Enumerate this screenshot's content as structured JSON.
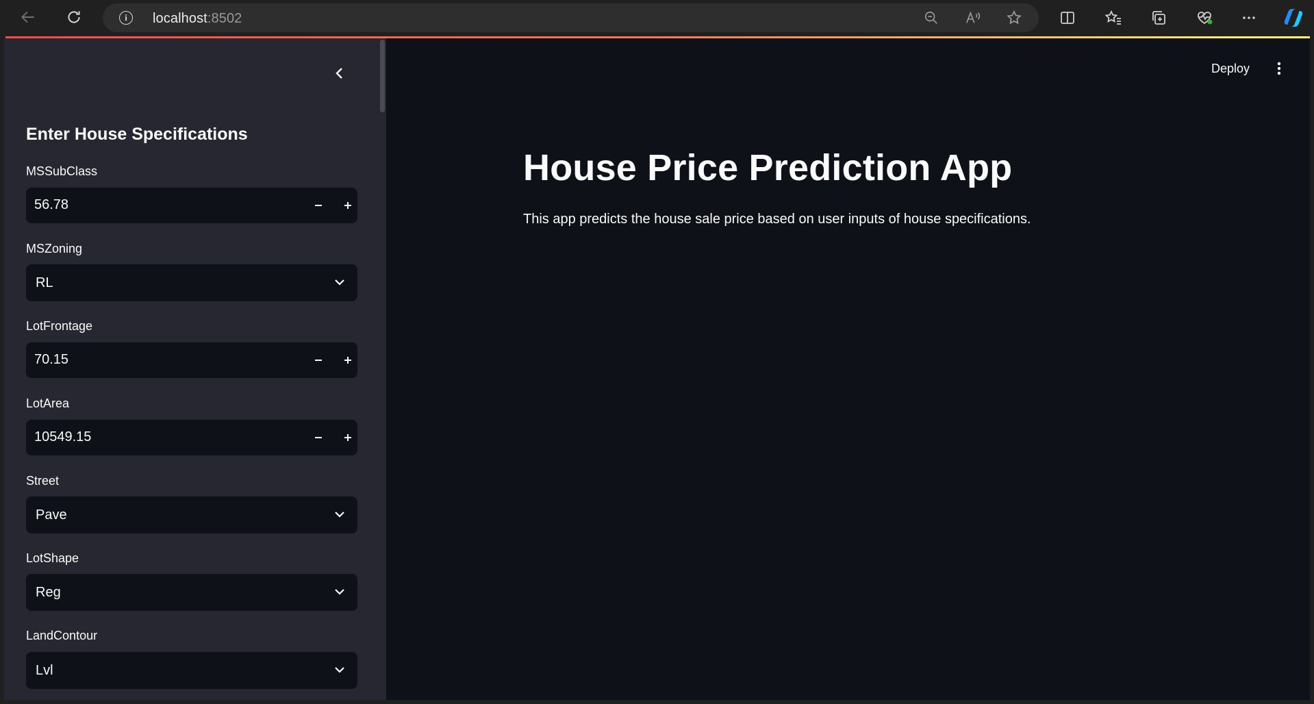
{
  "browser": {
    "url_host": "localhost",
    "url_port": ":8502"
  },
  "header": {
    "deploy_label": "Deploy"
  },
  "sidebar": {
    "title": "Enter House Specifications",
    "fields": [
      {
        "label": "MSSubClass",
        "type": "number",
        "value": "56.78"
      },
      {
        "label": "MSZoning",
        "type": "select",
        "value": "RL"
      },
      {
        "label": "LotFrontage",
        "type": "number",
        "value": "70.15"
      },
      {
        "label": "LotArea",
        "type": "number",
        "value": "10549.15"
      },
      {
        "label": "Street",
        "type": "select",
        "value": "Pave"
      },
      {
        "label": "LotShape",
        "type": "select",
        "value": "Reg"
      },
      {
        "label": "LandContour",
        "type": "select",
        "value": "Lvl"
      }
    ]
  },
  "main": {
    "title": "House Price Prediction App",
    "description": "This app predicts the house sale price based on user inputs of house specifications."
  },
  "colors": {
    "app_bg": "#0e1117",
    "sidebar_bg": "#262730",
    "text": "#fafafa",
    "accent_start": "#ff4b4b",
    "accent_end": "#fffd80"
  }
}
